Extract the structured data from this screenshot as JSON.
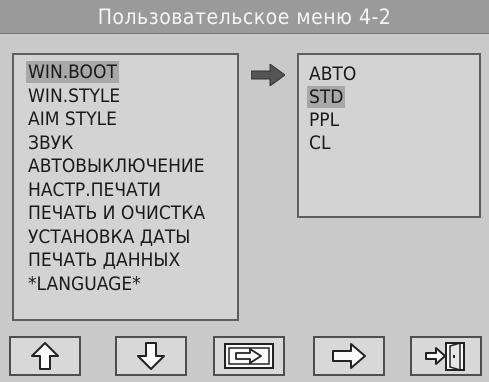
{
  "title": "Пользовательское меню 4-2",
  "menu": {
    "items": [
      {
        "label": "WIN.BOOT",
        "selected": true
      },
      {
        "label": "WIN.STYLE",
        "selected": false
      },
      {
        "label": "AIM STYLE",
        "selected": false
      },
      {
        "label": "ЗВУК",
        "selected": false
      },
      {
        "label": "АВТОВЫКЛЮЧЕНИЕ",
        "selected": false
      },
      {
        "label": "НАСТР.ПЕЧАТИ",
        "selected": false
      },
      {
        "label": "ПЕЧАТЬ И ОЧИСТКА",
        "selected": false
      },
      {
        "label": "УСТАНОВКА ДАТЫ",
        "selected": false
      },
      {
        "label": "ПЕЧАТЬ ДАННЫХ",
        "selected": false
      },
      {
        "label": "*LANGUAGE*",
        "selected": false
      }
    ]
  },
  "options": {
    "items": [
      {
        "label": "АВТО",
        "selected": false
      },
      {
        "label": "STD",
        "selected": true
      },
      {
        "label": "PPL",
        "selected": false
      },
      {
        "label": "CL",
        "selected": false
      }
    ]
  },
  "buttons": {
    "up": "arrow-up-icon",
    "down": "arrow-down-icon",
    "switch_panel": "switch-panel-icon",
    "enter": "arrow-right-icon",
    "exit": "exit-door-icon"
  },
  "colors": {
    "background": "#c9c9c9",
    "title_bar": "#9a9a9a",
    "highlight": "#a8a8a8",
    "text": "#1a1a1a"
  }
}
